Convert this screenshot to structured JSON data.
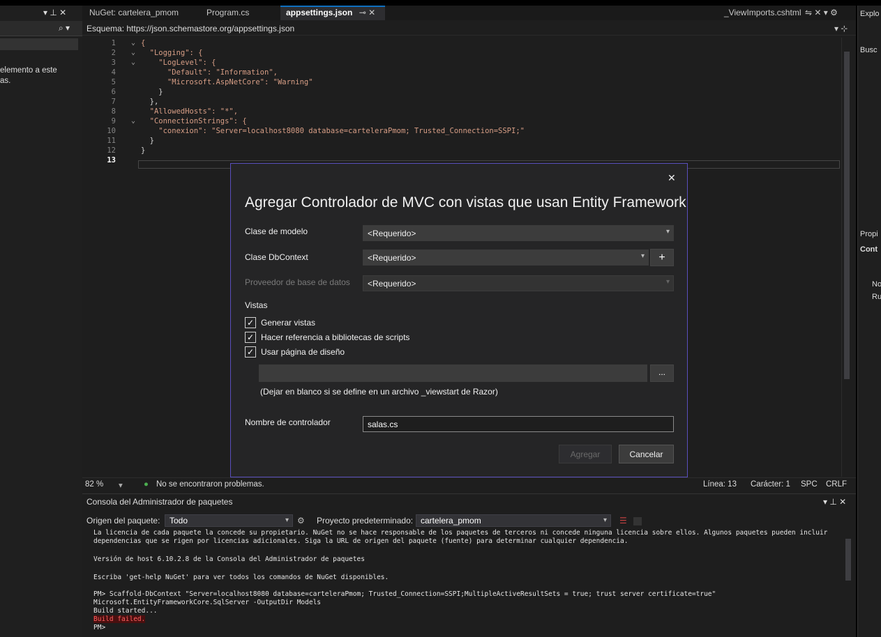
{
  "left_panel": {
    "pin_icons": "▾ ⊥ ✕",
    "search_icon_glyph": "⌕ ▾",
    "text_line1": "elemento a este",
    "text_line2": "as."
  },
  "tabs": [
    {
      "label": "NuGet: cartelera_pmom"
    },
    {
      "label": "Program.cs"
    },
    {
      "label": "appsettings.json"
    },
    {
      "label": "_ViewImports.cshtml"
    }
  ],
  "tab_active_pin": "⊸ ✕",
  "tab_right_icons": "⇋ ✕ ▾ ⚙",
  "schema_bar": {
    "label": "Esquema: https://json.schemastore.org/appsettings.json",
    "split_icon": "▾ ⊹"
  },
  "code": {
    "line_numbers": [
      "1",
      "2",
      "3",
      "4",
      "5",
      "6",
      "7",
      "8",
      "9",
      "10",
      "11",
      "12",
      "13"
    ],
    "lines": [
      "{",
      "  \"Logging\": {",
      "    \"LogLevel\": {",
      "      \"Default\": \"Information\",",
      "      \"Microsoft.AspNetCore\": \"Warning\"",
      "    }",
      "  },",
      "  \"AllowedHosts\": \"*\",",
      "  \"ConnectionStrings\": {",
      "    \"conexion\": \"Server=localhost8080 database=carteleraPmom; Trusted_Connection=SSPI;\"",
      "  }",
      "}",
      ""
    ],
    "fold_marks": [
      "⌄",
      "⌄",
      "⌄",
      "",
      "",
      "",
      "",
      "",
      "⌄",
      "",
      "",
      "",
      ""
    ]
  },
  "status_bar": {
    "zoom": "82 %",
    "zoom_chevron": "▾",
    "issues": "No se encontraron problemas.",
    "line": "Línea: 13",
    "char": "Carácter: 1",
    "spc": "SPC",
    "crlf": "CRLF"
  },
  "right_panel": {
    "title": "Explo",
    "search": "Busc",
    "props_title": "Propi",
    "props_sub": "Cont",
    "item1": "No",
    "item2": "Ru"
  },
  "dialog": {
    "title": "Agregar Controlador de MVC con vistas que usan Entity Framework",
    "close": "✕",
    "model_class_label": "Clase de modelo",
    "model_class_value": "<Requerido>",
    "dbcontext_label": "Clase DbContext",
    "dbcontext_value": "<Requerido>",
    "add_dbcontext": "+",
    "provider_label": "Proveedor de base de datos",
    "provider_value": "<Requerido>",
    "views_header": "Vistas",
    "checkboxes": [
      {
        "label": "Generar vistas",
        "checked": "✓"
      },
      {
        "label": "Hacer referencia a bibliotecas de scripts",
        "checked": "✓"
      },
      {
        "label": "Usar página de diseño",
        "checked": "✓"
      }
    ],
    "browse_label": "...",
    "layout_hint": "(Dejar en blanco si se define en un archivo _viewstart de Razor)",
    "controller_name_label": "Nombre de controlador",
    "controller_name_value": "salas.cs",
    "btn_add": "Agregar",
    "btn_cancel": "Cancelar"
  },
  "console": {
    "title": "Consola del Administrador de paquetes",
    "title_icons": "▾ ⊥ ✕",
    "source_label": "Origen del paquete:",
    "source_value": "Todo",
    "project_label": "Proyecto predeterminado:",
    "project_value": "cartelera_pmom",
    "lines": [
      "La licencia de cada paquete la concede su propietario. NuGet no se hace responsable de los paquetes de terceros ni concede ninguna licencia sobre ellos. Algunos paquetes pueden incluir",
      "dependencias que se rigen por licencias adicionales. Siga la URL de origen del paquete (fuente) para determinar cualquier dependencia.",
      "",
      "Versión de host 6.10.2.8 de la Consola del Administrador de paquetes",
      "",
      "Escriba 'get-help NuGet' para ver todos los comandos de NuGet disponibles.",
      "",
      "PM> Scaffold-DbContext \"Server=localhost8080 database=carteleraPmom; Trusted_Connection=SSPI;MultipleActiveResultSets = true; trust server certificate=true\"",
      "Microsoft.EntityFrameworkCore.SqlServer -OutputDir Models",
      "Build started...",
      "Build failed.",
      "PM>"
    ]
  }
}
